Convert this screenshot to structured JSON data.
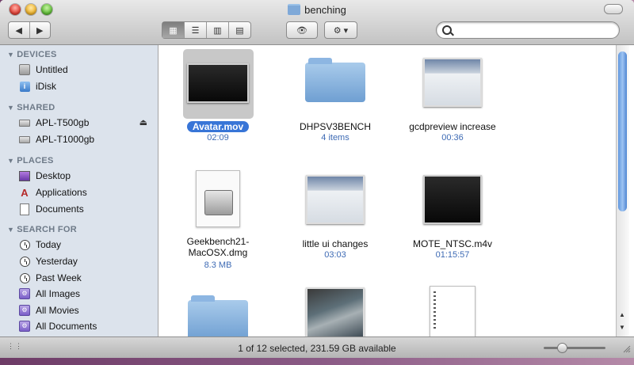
{
  "window": {
    "title": "benching"
  },
  "toolbar": {
    "back_glyph": "◀",
    "forward_glyph": "▶",
    "views": [
      {
        "name": "icon-view",
        "glyph": "▦"
      },
      {
        "name": "list-view",
        "glyph": "☰"
      },
      {
        "name": "column-view",
        "glyph": "▥"
      },
      {
        "name": "coverflow-view",
        "glyph": "▤"
      }
    ],
    "quicklook_glyph": "👁",
    "action_glyph": "⚙ ▾",
    "search": {
      "value": "",
      "placeholder": ""
    }
  },
  "sidebar": {
    "sections": [
      {
        "title": "DEVICES",
        "items": [
          "Untitled",
          "iDisk"
        ]
      },
      {
        "title": "SHARED",
        "items": [
          "APL-T500gb",
          "APL-T1000gb"
        ]
      },
      {
        "title": "PLACES",
        "items": [
          "Desktop",
          "Applications",
          "Documents"
        ]
      },
      {
        "title": "SEARCH FOR",
        "items": [
          "Today",
          "Yesterday",
          "Past Week",
          "All Images",
          "All Movies",
          "All Documents"
        ]
      }
    ],
    "eject_glyph": "⏏"
  },
  "files": [
    {
      "name": "Avatar.mov",
      "info": "02:09",
      "kind": "video",
      "selected": true
    },
    {
      "name": "DHPSV3BENCH",
      "info": "4 items",
      "kind": "folder"
    },
    {
      "name": "gcdpreview increase",
      "info": "00:36",
      "kind": "video"
    },
    {
      "name": "Geekbench21-MacOSX.dmg",
      "info": "8.3 MB",
      "kind": "dmg",
      "line1": "Geekbench21-",
      "line2": "MacOSX.dmg"
    },
    {
      "name": "little ui changes",
      "info": "03:03",
      "kind": "screenshot"
    },
    {
      "name": "MOTE_NTSC.m4v",
      "info": "01:15:57",
      "kind": "video"
    },
    {
      "name": "",
      "info": "",
      "kind": "folder"
    },
    {
      "name": "",
      "info": "",
      "kind": "photo"
    },
    {
      "name": "",
      "info": "",
      "kind": "document"
    }
  ],
  "status": {
    "text": "1 of 12 selected, 231.59 GB available"
  },
  "icon_size_slider": {
    "value": 0.3
  },
  "colors": {
    "selection": "#3875d7",
    "sidebar_bg": "#dce3ec",
    "info_text": "#3d6ab4"
  }
}
